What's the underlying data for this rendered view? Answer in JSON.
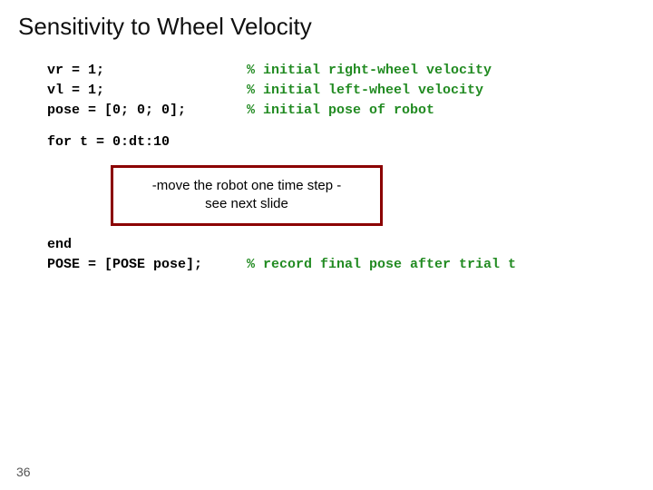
{
  "title": "Sensitivity to Wheel Velocity",
  "code": {
    "line1_left": "vr = 1;",
    "line1_right": "% initial right-wheel velocity",
    "line2_left": "vl = 1;",
    "line2_right": "% initial left-wheel velocity",
    "line3_left": "pose = [0; 0; 0];",
    "line3_right": "% initial pose of robot",
    "line4": "for t = 0:dt:10",
    "line5": "end",
    "line6_left": "POSE = [POSE pose];",
    "line6_right": "% record final pose after trial t"
  },
  "callout_line1": "-move the robot one time step -",
  "callout_line2": "see next slide",
  "page_number": "36"
}
